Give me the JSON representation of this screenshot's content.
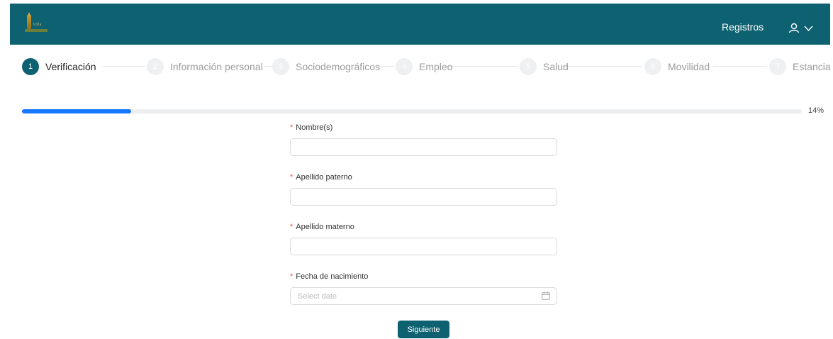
{
  "header": {
    "logo_text": "Villa",
    "nav_registros": "Registros",
    "colors": {
      "header_bg": "#0e6170",
      "accent": "#1677ff"
    }
  },
  "steps": [
    {
      "number": "1",
      "label": "Verificación",
      "active": true
    },
    {
      "number": "2",
      "label": "Información personal",
      "active": false
    },
    {
      "number": "3",
      "label": "Sociodemográficos",
      "active": false
    },
    {
      "number": "4",
      "label": "Empleo",
      "active": false
    },
    {
      "number": "5",
      "label": "Salud",
      "active": false
    },
    {
      "number": "6",
      "label": "Movilidad",
      "active": false
    },
    {
      "number": "7",
      "label": "Estancia",
      "active": false
    }
  ],
  "progress": {
    "value": 0.14,
    "text": "14%"
  },
  "form": {
    "required_mark": "*",
    "nombre": {
      "label": "Nombre(s)",
      "value": "",
      "placeholder": ""
    },
    "apellido_paterno": {
      "label": "Apellido paterno",
      "value": "",
      "placeholder": ""
    },
    "apellido_materno": {
      "label": "Apellido materno",
      "value": "",
      "placeholder": ""
    },
    "fecha_nacimiento": {
      "label": "Fecha de nacimiento",
      "value": "",
      "placeholder": "Select date",
      "icon": "calendar-icon"
    },
    "submit_label": "Siguiente"
  }
}
